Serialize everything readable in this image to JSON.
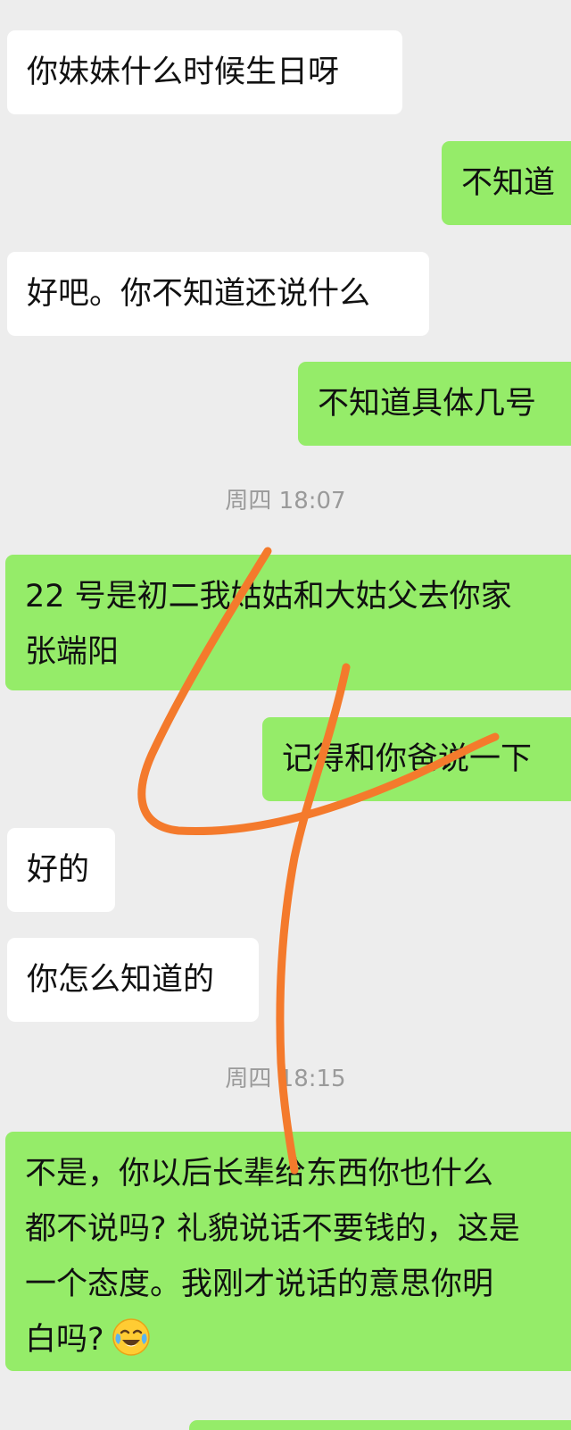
{
  "messages": [
    {
      "id": "m1",
      "side": "in",
      "text": "你妹妹什么时候生日呀"
    },
    {
      "id": "m2",
      "side": "out",
      "text": "不知道"
    },
    {
      "id": "m3",
      "side": "in",
      "text": "好吧。你不知道还说什么"
    },
    {
      "id": "m4",
      "side": "out",
      "text": "不知道具体几号"
    },
    {
      "id": "m5",
      "side": "out",
      "lines": [
        "22 号是初二我姑姑和大姑父去你家",
        "张端阳"
      ]
    },
    {
      "id": "m6",
      "side": "out",
      "text": "记得和你爸说一下"
    },
    {
      "id": "m7",
      "side": "in",
      "text": "好的"
    },
    {
      "id": "m8",
      "side": "in",
      "text": "你怎么知道的"
    },
    {
      "id": "m9",
      "side": "out",
      "lines": [
        "不是，你以后长辈给东西你也什么",
        "都不说吗? 礼貌说话不要钱的，这是",
        "一个态度。我刚才说话的意思你明",
        "白吗?"
      ],
      "emoji": "face-with-tears-of-joy"
    }
  ],
  "timestamps": [
    "周四 18:07",
    "周四 18:15"
  ],
  "colors": {
    "background": "#ededed",
    "incoming_bubble": "#ffffff",
    "outgoing_bubble": "#95ec69",
    "annotation_stroke": "#f47a2c"
  }
}
